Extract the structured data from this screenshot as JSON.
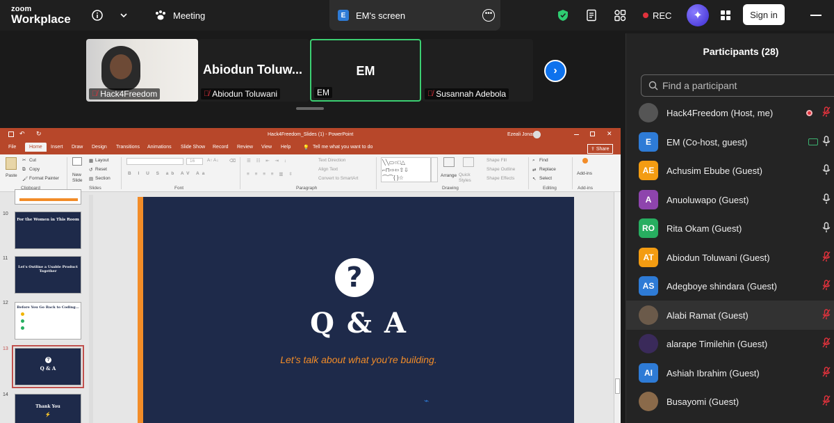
{
  "topbar": {
    "logo_top": "zoom",
    "logo_bottom": "Workplace",
    "info_icon": "info-icon",
    "meeting_label": "Meeting",
    "screen_tab_badge": "E",
    "screen_tab_label": "EM's screen",
    "rec_label": "REC",
    "signin_label": "Sign in"
  },
  "gallery": {
    "tiles": [
      {
        "name": "Hack4Freedom"
      },
      {
        "name": "Abiodun Toluwani",
        "big_name": "Abiodun  Toluw..."
      },
      {
        "name": "EM",
        "center": "EM"
      },
      {
        "name": "Susannah Adebola"
      }
    ],
    "next_icon": "chevron-right-icon"
  },
  "ppt": {
    "title": "Hack4Freedom_Slides (1)  -  PowerPoint",
    "user": "Ezeali Jonas",
    "tabs": [
      "File",
      "Home",
      "Insert",
      "Draw",
      "Design",
      "Transitions",
      "Animations",
      "Slide Show",
      "Record",
      "Review",
      "View",
      "Help"
    ],
    "tell_me": "Tell me what you want to do",
    "share": "Share",
    "ribbon": {
      "paste": "Paste",
      "cut": "Cut",
      "copy": "Copy",
      "format_painter": "Format Painter",
      "clipboard": "Clipboard",
      "new_slide": "New Slide",
      "layout": "Layout",
      "reset": "Reset",
      "section": "Section",
      "slides": "Slides",
      "font": "Font",
      "paragraph": "Paragraph",
      "text_direction": "Text Direction",
      "align_text": "Align Text",
      "convert_smartart": "Convert to SmartArt",
      "drawing": "Drawing",
      "arrange": "Arrange",
      "quick_styles": "Quick Styles",
      "shape_fill": "Shape Fill",
      "shape_outline": "Shape Outline",
      "shape_effects": "Shape Effects",
      "find": "Find",
      "replace": "Replace",
      "select": "Select",
      "editing": "Editing",
      "addins": "Add-ins",
      "addins_group": "Add-ins",
      "font_size": "16"
    },
    "thumbs": [
      {
        "num": "10",
        "title": "For the Women in This Room"
      },
      {
        "num": "11",
        "title": "Let's Outline a Usable Product Together"
      },
      {
        "num": "12",
        "title": "Before You Go Back to Coding..."
      },
      {
        "num": "13",
        "title": "Q & A"
      },
      {
        "num": "14",
        "title": "Thank You"
      }
    ],
    "slide": {
      "title": "Q & A",
      "subtitle": "Let’s talk about what you’re building."
    }
  },
  "participants": {
    "title": "Participants (28)",
    "search_placeholder": "Find a participant",
    "list": [
      {
        "name": "Hack4Freedom (Host, me)",
        "initials": "",
        "color": "#555555",
        "mic": "off",
        "extra": "rec"
      },
      {
        "name": "EM (Co-host, guest)",
        "initials": "E",
        "color": "#2e7bd6",
        "mic": "on",
        "extra": "share"
      },
      {
        "name": "Achusim Ebube (Guest)",
        "initials": "AE",
        "color": "#f39c12",
        "mic": "on"
      },
      {
        "name": "Anuoluwapo (Guest)",
        "initials": "A",
        "color": "#8e44ad",
        "mic": "on"
      },
      {
        "name": "Rita Okam (Guest)",
        "initials": "RO",
        "color": "#27ae60",
        "mic": "on"
      },
      {
        "name": "Abiodun Toluwani (Guest)",
        "initials": "AT",
        "color": "#f39c12",
        "mic": "off"
      },
      {
        "name": "Adegboye shindara (Guest)",
        "initials": "AS",
        "color": "#2e7bd6",
        "mic": "off"
      },
      {
        "name": "Alabi Ramat (Guest)",
        "initials": "",
        "color": "#6b5a4a",
        "mic": "off",
        "highlight": true
      },
      {
        "name": "alarape Timilehin (Guest)",
        "initials": "",
        "color": "#3a2a5a",
        "mic": "off"
      },
      {
        "name": "Ashiah Ibrahim (Guest)",
        "initials": "AI",
        "color": "#2e7bd6",
        "mic": "off"
      },
      {
        "name": "Busayomi (Guest)",
        "initials": "",
        "color": "#8a6a4a",
        "mic": "off"
      }
    ]
  }
}
